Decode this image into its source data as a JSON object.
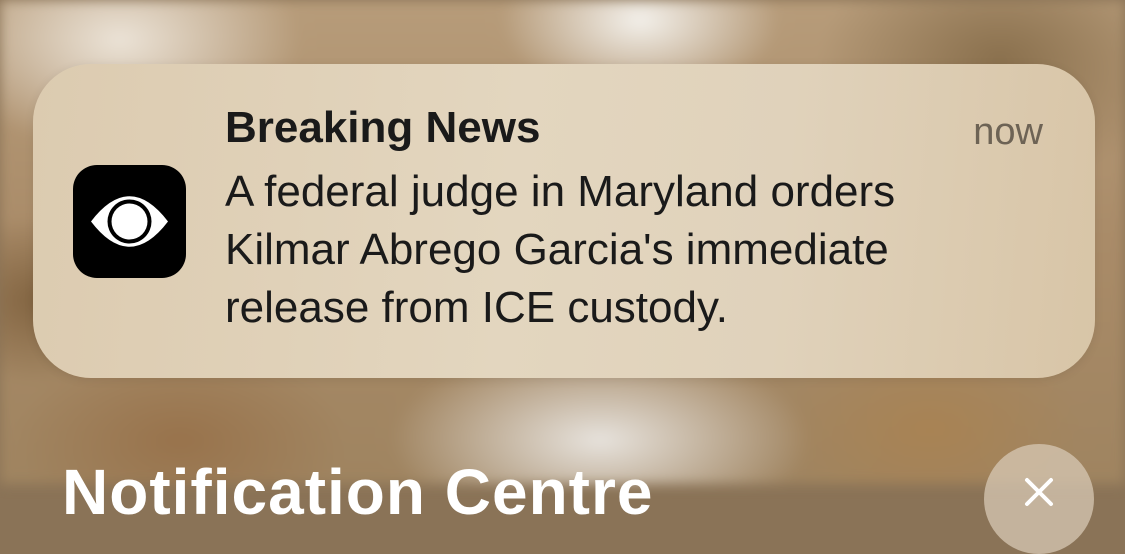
{
  "notification": {
    "app_icon": "cbs-eye-icon",
    "title": "Breaking News",
    "timestamp": "now",
    "message_lines": [
      "A federal judge in Maryland orders",
      "Kilmar Abrego Garcia's immediate",
      "release from ICE custody."
    ]
  },
  "notification_center": {
    "header_label": "Notification Centre",
    "clear_icon": "close-icon"
  },
  "colors": {
    "banner_bg": "#e0d2bb",
    "text_primary": "#1a1a1a",
    "text_secondary": "#6d6355",
    "icon_bg": "#000000"
  }
}
